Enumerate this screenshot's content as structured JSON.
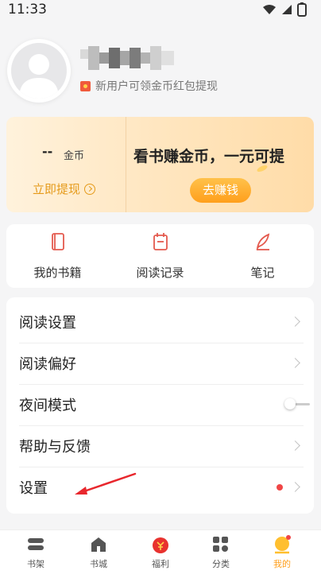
{
  "status_bar": {
    "time": "11:33"
  },
  "profile": {
    "tip": "新用户可领金币红包提现"
  },
  "coin_card": {
    "coin_value": "--",
    "coin_unit": "金币",
    "withdraw_label": "立即提现",
    "promo_title": "看书赚金币，一元可提",
    "earn_button": "去赚钱"
  },
  "quick_links": [
    {
      "label": "我的书籍",
      "icon": "book-icon"
    },
    {
      "label": "阅读记录",
      "icon": "history-icon"
    },
    {
      "label": "笔记",
      "icon": "pen-icon"
    }
  ],
  "menu": [
    {
      "label": "阅读设置",
      "type": "chevron"
    },
    {
      "label": "阅读偏好",
      "type": "chevron"
    },
    {
      "label": "夜间模式",
      "type": "toggle",
      "value": "off"
    },
    {
      "label": "帮助与反馈",
      "type": "chevron"
    },
    {
      "label": "设置",
      "type": "chevron",
      "badge": "red-dot"
    }
  ],
  "bottom_nav": [
    {
      "label": "书架",
      "icon": "bookshelf-icon"
    },
    {
      "label": "书城",
      "icon": "store-icon"
    },
    {
      "label": "福利",
      "icon": "gift-icon"
    },
    {
      "label": "分类",
      "icon": "category-icon"
    },
    {
      "label": "我的",
      "icon": "profile-icon",
      "active": true
    }
  ],
  "colors": {
    "accent": "#ff9f1c",
    "badge": "#f04545",
    "icon_red": "#e45a4e"
  }
}
